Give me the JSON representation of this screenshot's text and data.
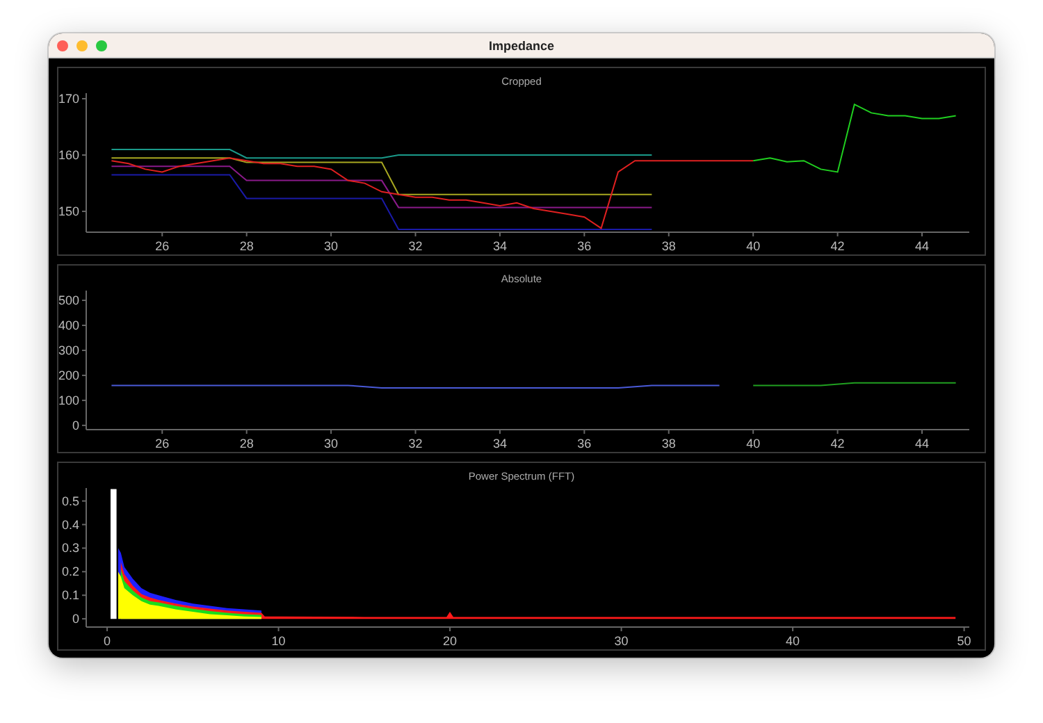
{
  "window": {
    "title": "Impedance"
  },
  "panels": [
    {
      "chart_data": {
        "type": "line",
        "title": "Cropped",
        "xlim": [
          24.2,
          45.12
        ],
        "ylim": [
          146.3,
          171
        ],
        "xticks": [
          26,
          28,
          30,
          32,
          34,
          36,
          38,
          40,
          42,
          44
        ],
        "yticks": [
          150,
          160,
          170
        ],
        "x": [
          24.8,
          25.2,
          25.6,
          26.0,
          26.4,
          26.8,
          27.2,
          27.6,
          28.0,
          28.4,
          28.8,
          29.2,
          29.6,
          30.0,
          30.4,
          30.8,
          31.2,
          31.6,
          32.0,
          32.4,
          32.8,
          33.2,
          33.6,
          34.0,
          34.4,
          34.8,
          35.2,
          35.6,
          36.0,
          36.4,
          36.8,
          37.2,
          37.6,
          38.0,
          38.4,
          38.8,
          39.2,
          39.6,
          40.0,
          40.4,
          40.8,
          41.2,
          41.6,
          42.0,
          42.4,
          42.8,
          43.2,
          43.6,
          44.0,
          44.4,
          44.8
        ],
        "series": [
          {
            "color": "#1a1aa8",
            "values": [
              156.5,
              156.5,
              156.5,
              156.5,
              156.5,
              156.5,
              156.5,
              156.5,
              152.3,
              152.3,
              152.3,
              152.3,
              152.3,
              152.3,
              152.3,
              152.3,
              152.3,
              146.8,
              146.8,
              146.8,
              146.8,
              146.8,
              146.8,
              146.8,
              146.8,
              146.8,
              146.8,
              146.8,
              146.8,
              146.8,
              146.8,
              146.8,
              146.8,
              null,
              null,
              null,
              null,
              null,
              null,
              null,
              null,
              null,
              null,
              null,
              null,
              null,
              null,
              null,
              null,
              null,
              null
            ]
          },
          {
            "color": "#8a1a8a",
            "values": [
              158,
              158,
              158,
              158,
              158,
              158,
              158,
              158,
              155.5,
              155.5,
              155.5,
              155.5,
              155.5,
              155.5,
              155.5,
              155.5,
              155.5,
              150.7,
              150.7,
              150.7,
              150.7,
              150.7,
              150.7,
              150.7,
              150.7,
              150.7,
              150.7,
              150.7,
              150.7,
              150.7,
              150.7,
              150.7,
              150.7,
              null,
              null,
              null,
              null,
              null,
              null,
              null,
              null,
              null,
              null,
              null,
              null,
              null,
              null,
              null,
              null,
              null,
              null
            ]
          },
          {
            "color": "#a8a820",
            "values": [
              159.5,
              159.5,
              159.5,
              159.5,
              159.5,
              159.5,
              159.5,
              159.5,
              158.7,
              158.7,
              158.7,
              158.7,
              158.7,
              158.7,
              158.7,
              158.7,
              158.7,
              153,
              153,
              153,
              153,
              153,
              153,
              153,
              153,
              153,
              153,
              153,
              153,
              153,
              153,
              153,
              153,
              null,
              null,
              null,
              null,
              null,
              null,
              null,
              null,
              null,
              null,
              null,
              null,
              null,
              null,
              null,
              null,
              null,
              null
            ]
          },
          {
            "color": "#1a9a8a",
            "values": [
              161,
              161,
              161,
              161,
              161,
              161,
              161,
              161,
              159.5,
              159.5,
              159.5,
              159.5,
              159.5,
              159.5,
              159.5,
              159.5,
              159.5,
              160,
              160,
              160,
              160,
              160,
              160,
              160,
              160,
              160,
              160,
              160,
              160,
              160,
              160,
              160,
              160,
              null,
              null,
              null,
              null,
              null,
              null,
              null,
              null,
              null,
              null,
              null,
              null,
              null,
              null,
              null,
              null,
              null,
              null
            ]
          },
          {
            "color": "#e02020",
            "values": [
              159,
              158.5,
              157.5,
              157,
              158,
              158.5,
              159,
              159.5,
              159,
              158.5,
              158.5,
              158,
              158,
              157.5,
              155.5,
              155,
              153.5,
              153,
              152.5,
              152.5,
              152,
              152,
              151.5,
              151,
              151.5,
              150.5,
              150,
              149.5,
              149,
              147,
              157,
              159,
              159,
              159,
              159,
              159,
              159,
              159,
              159,
              null,
              null,
              null,
              null,
              null,
              null,
              null,
              null,
              null,
              null,
              null,
              null
            ]
          },
          {
            "color": "#20d020",
            "values": [
              null,
              null,
              null,
              null,
              null,
              null,
              null,
              null,
              null,
              null,
              null,
              null,
              null,
              null,
              null,
              null,
              null,
              null,
              null,
              null,
              null,
              null,
              null,
              null,
              null,
              null,
              null,
              null,
              null,
              null,
              null,
              null,
              null,
              null,
              null,
              null,
              null,
              null,
              159,
              159.5,
              158.8,
              159,
              157.5,
              157,
              169,
              167.5,
              167,
              167,
              166.5,
              166.5,
              167
            ]
          }
        ]
      }
    },
    {
      "chart_data": {
        "type": "line",
        "title": "Absolute",
        "xlim": [
          24.2,
          45.12
        ],
        "ylim": [
          -17,
          539
        ],
        "xticks": [
          26,
          28,
          30,
          32,
          34,
          36,
          38,
          40,
          42,
          44
        ],
        "yticks": [
          0,
          100,
          200,
          300,
          400,
          500
        ],
        "x": [
          24.8,
          25.6,
          26.4,
          27.2,
          28.0,
          28.8,
          29.6,
          30.4,
          31.2,
          32.0,
          32.8,
          33.6,
          34.4,
          35.2,
          36.0,
          36.8,
          37.6,
          38.4,
          39.2,
          40.0,
          40.8,
          41.6,
          42.4,
          43.2,
          44.0,
          44.8
        ],
        "series": [
          {
            "color": "#4a5ad8",
            "values": [
              160,
              160,
              160,
              160,
              160,
              160,
              160,
              160,
              150,
              150,
              150,
              150,
              150,
              150,
              150,
              150,
              160,
              160,
              160,
              null,
              null,
              null,
              null,
              null,
              null,
              null
            ]
          },
          {
            "color": "#20a020",
            "values": [
              null,
              null,
              null,
              null,
              null,
              null,
              null,
              null,
              null,
              null,
              null,
              null,
              null,
              null,
              null,
              null,
              null,
              null,
              null,
              160,
              160,
              160,
              170,
              170,
              170,
              170
            ]
          }
        ]
      }
    },
    {
      "chart_data": {
        "type": "area",
        "title": "Power Spectrum (FFT)",
        "xlim": [
          -1.22,
          50.3
        ],
        "ylim": [
          -0.035,
          0.555
        ],
        "xticks": [
          0,
          10,
          20,
          30,
          40,
          50
        ],
        "yticks": [
          0,
          0.1,
          0.2,
          0.3,
          0.4,
          0.5
        ],
        "x": [
          0.2,
          0.55,
          0.65,
          0.8,
          1,
          1.5,
          2,
          2.5,
          3,
          4,
          5,
          6,
          7,
          8,
          9,
          9.2,
          10,
          15,
          19.8,
          20,
          20.2,
          25,
          30,
          35,
          40,
          45,
          49.5
        ],
        "series": [
          {
            "color": "#2020ff",
            "values": [
              null,
              null,
              0.3,
              0.28,
              0.22,
              0.17,
              0.13,
              0.11,
              0.1,
              0.08,
              0.065,
              0.055,
              0.045,
              0.04,
              0.035,
              null,
              null,
              null,
              null,
              null,
              null,
              null,
              null,
              null,
              null,
              null,
              null
            ]
          },
          {
            "color": "#ff1a1a",
            "values": [
              null,
              null,
              null,
              0.24,
              0.19,
              0.14,
              0.105,
              0.09,
              0.08,
              0.065,
              0.052,
              0.043,
              0.035,
              0.03,
              0.025,
              0.01,
              0.01,
              0.008,
              0.008,
              0.03,
              0.008,
              0.008,
              0.008,
              0.008,
              0.008,
              0.008,
              0.008
            ]
          },
          {
            "color": "#1adc1a",
            "values": [
              null,
              null,
              null,
              0.21,
              0.16,
              0.12,
              0.09,
              0.075,
              0.07,
              0.055,
              0.042,
              0.033,
              0.026,
              0.02,
              0.017,
              null,
              null,
              null,
              null,
              null,
              null,
              null,
              null,
              null,
              null,
              null,
              null
            ]
          },
          {
            "color": "#ffff00",
            "values": [
              null,
              null,
              0.2,
              0.18,
              0.13,
              0.1,
              0.075,
              0.06,
              0.055,
              0.04,
              0.03,
              0.02,
              0.015,
              0.01,
              0.008,
              null,
              null,
              null,
              null,
              null,
              null,
              null,
              null,
              null,
              null,
              null,
              null
            ]
          },
          {
            "color": "#ffffff",
            "values": [
              0.55,
              0.55,
              null,
              null,
              null,
              null,
              null,
              null,
              null,
              null,
              null,
              null,
              null,
              null,
              null,
              null,
              null,
              null,
              null,
              null,
              null,
              null,
              null,
              null,
              null,
              null,
              null
            ]
          }
        ]
      }
    }
  ]
}
